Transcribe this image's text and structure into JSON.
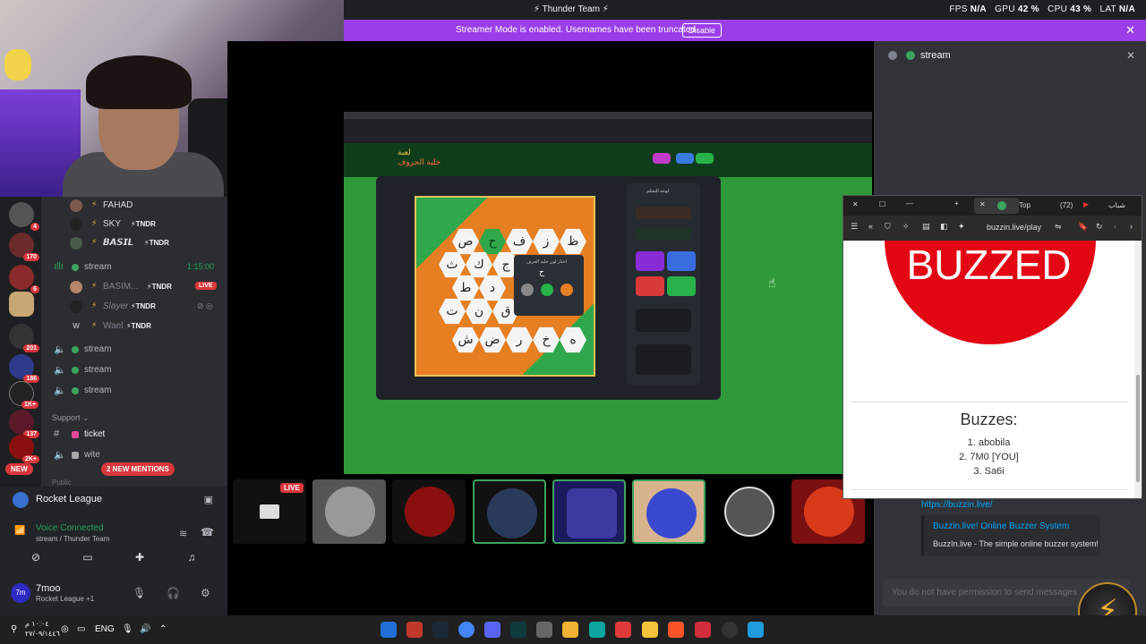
{
  "titlebar": {
    "title": "Thunder Team",
    "fps_label": "FPS",
    "fps_value": "N/A",
    "gpu_label": "GPU",
    "gpu_value": "42 %",
    "cpu_label": "CPU",
    "cpu_value": "43 %",
    "lat_label": "LAT",
    "lat_value": "N/A"
  },
  "banner": {
    "text": "Streamer Mode is enabled. Usernames have been truncated.",
    "button": "Disable"
  },
  "servers": {
    "badges": [
      "4",
      "170",
      "6",
      "201",
      "186",
      "1K+",
      "137",
      "2K+"
    ],
    "new_label": "NEW"
  },
  "voice": {
    "users_top": [
      {
        "name": "FAHAD",
        "tag": ""
      },
      {
        "name": "SKY",
        "tag": "TNDR"
      },
      {
        "name": "𝘽𝘼𝙎𝙄𝙇",
        "tag": "TNDR"
      }
    ],
    "stream_channel": {
      "name": "stream",
      "time": "1:15:00"
    },
    "users_stream": [
      {
        "name": "BASIM...",
        "tag": "TNDR",
        "live": "LIVE"
      },
      {
        "name": "Slayer",
        "tag": "TNDR"
      },
      {
        "name": "Wael",
        "tag": "TNDR"
      }
    ],
    "other_channels": [
      "stream",
      "stream",
      "stream"
    ],
    "category": "Support",
    "text_channels": [
      "ticket",
      "wite"
    ],
    "mentions": "2 NEW MENTIONS",
    "cut_label": "Public"
  },
  "userpanel": {
    "game": "Rocket League",
    "vc_status": "Voice Connected",
    "vc_sub": "stream / Thunder Team",
    "username": "7moo",
    "user_sub": "Rocket League +1",
    "avatar_text": "7m"
  },
  "stream": {
    "header_title": "stream",
    "live": "LIVE"
  },
  "game": {
    "logo1": "لعبة",
    "logo2": "خلية الحروف",
    "panel_title": "لوحة التحكم",
    "popup_title": "اختار لون خلية الحرف",
    "popup_letter": "ح",
    "grid": [
      [
        "ص",
        "ح",
        "ف",
        "ز",
        "ظ"
      ],
      [
        "ث",
        "ك",
        "ج",
        "",
        ""
      ],
      [
        "ط",
        "د",
        "",
        "",
        ""
      ],
      [
        "ت",
        "ن",
        "ق",
        "",
        ""
      ],
      [
        "ش",
        "ض",
        "ر",
        "خ",
        "ه"
      ]
    ]
  },
  "chat": {
    "link": "https://buzzin.live/",
    "embed_title": "Buzzin.live! Online Buzzer System",
    "embed_desc": "BuzzIn.live - The simple online buzzer system!",
    "placeholder": "You do not have permission to send messages"
  },
  "browser": {
    "tab_title": "Top",
    "tab_count": "(72)",
    "tab_right": "شباب",
    "url": "buzzin.live/play",
    "buzzed": "BUZZED",
    "buzzes_label": "Buzzes:",
    "buzzes": [
      "1. abobila",
      "2. 7M0 [YOU]",
      "3. Sa6i"
    ]
  },
  "taskbar": {
    "time": "١٠:٠٤ م",
    "date": "٢٧/٠٩/١٤٤٦",
    "lang": "ENG"
  },
  "colors": {
    "accent": "#9b3ee8",
    "discord_green": "#23a55a",
    "live_red": "#da373c",
    "buzz_red": "#e30613",
    "board_green": "#2ea84a",
    "board_orange": "#e67e22"
  }
}
